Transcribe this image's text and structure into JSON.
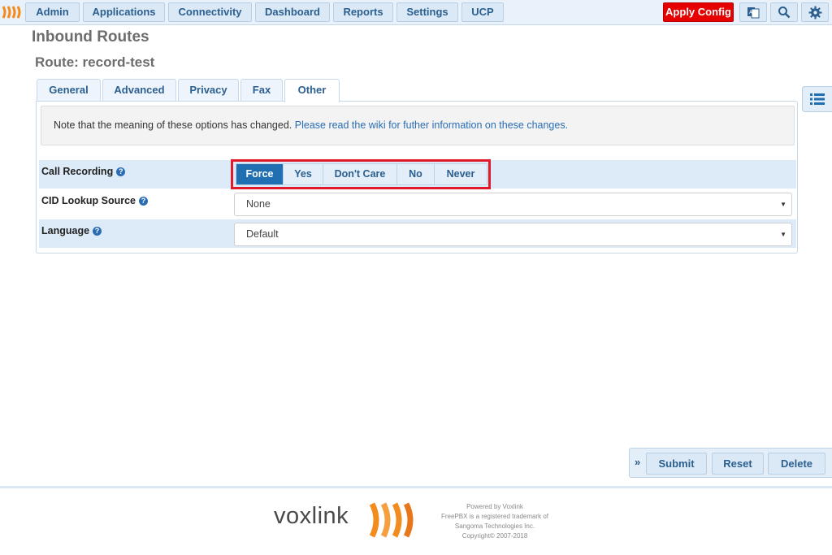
{
  "nav": {
    "items": [
      "Admin",
      "Applications",
      "Connectivity",
      "Dashboard",
      "Reports",
      "Settings",
      "UCP"
    ],
    "apply_label": "Apply Config"
  },
  "page": {
    "title": "Inbound Routes",
    "route_title": "Route: record-test"
  },
  "tabs": [
    "General",
    "Advanced",
    "Privacy",
    "Fax",
    "Other"
  ],
  "active_tab": "Other",
  "note": {
    "text": "Note that the meaning of these options has changed. ",
    "link": "Please read the wiki for futher information on these changes."
  },
  "form": {
    "call_recording": {
      "label": "Call Recording",
      "options": [
        "Force",
        "Yes",
        "Don't Care",
        "No",
        "Never"
      ],
      "selected": "Force"
    },
    "cid_lookup": {
      "label": "CID Lookup Source",
      "value": "None"
    },
    "language": {
      "label": "Language",
      "value": "Default"
    }
  },
  "actions": {
    "submit": "Submit",
    "reset": "Reset",
    "delete": "Delete"
  },
  "footer": {
    "brand": "voxlink",
    "powered": "Powered by Voxlink",
    "trademark1": "FreePBX is a registered trademark of",
    "trademark2": "Sangoma Technologies Inc.",
    "copyright": "Copyright© 2007-2018"
  },
  "colors": {
    "accent": "#1f6fb2",
    "apply": "#e60000",
    "highlight": "#e0192b",
    "brand_orange": "#f28c1e"
  },
  "icons": [
    "language-icon",
    "search-icon",
    "gear-icon",
    "list-icon",
    "double-chevron-icon"
  ]
}
